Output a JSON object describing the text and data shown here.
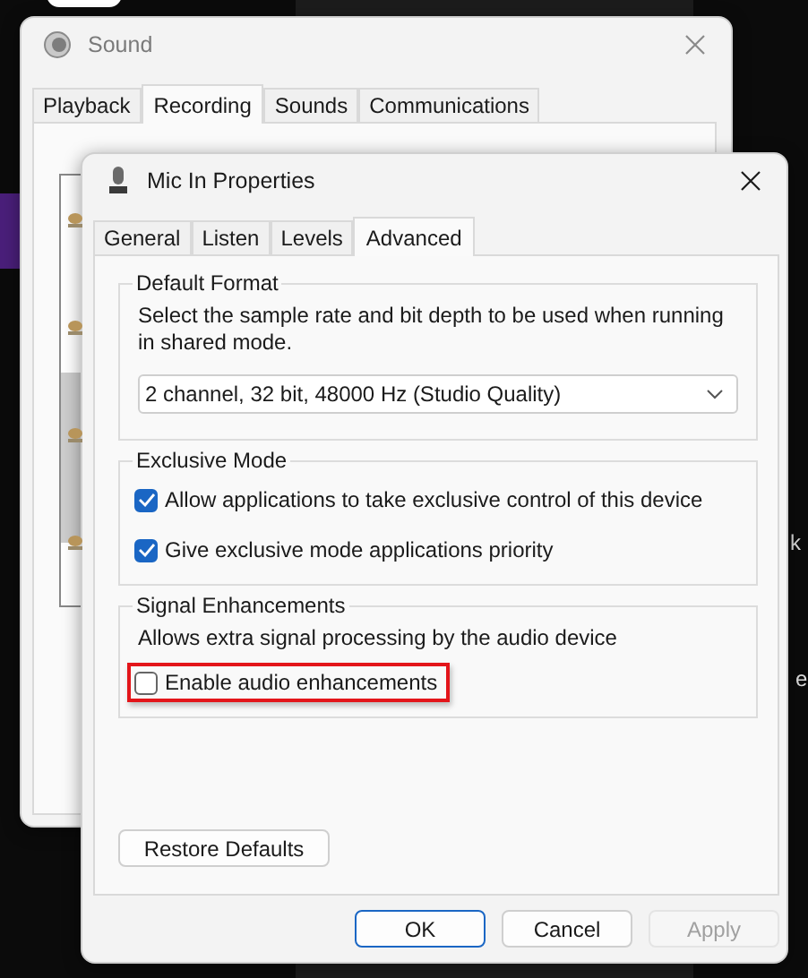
{
  "background": {
    "fragments": [
      "k",
      "e"
    ]
  },
  "sound_window": {
    "title": "Sound",
    "tabs": [
      {
        "label": "Playback",
        "selected": false
      },
      {
        "label": "Recording",
        "selected": true
      },
      {
        "label": "Sounds",
        "selected": false
      },
      {
        "label": "Communications",
        "selected": false
      }
    ]
  },
  "dialog": {
    "title": "Mic In Properties",
    "tabs": [
      {
        "label": "General",
        "selected": false
      },
      {
        "label": "Listen",
        "selected": false
      },
      {
        "label": "Levels",
        "selected": false
      },
      {
        "label": "Advanced",
        "selected": true
      }
    ],
    "groups": [
      {
        "title": "Default Format",
        "description": "Select the sample rate and bit depth to be used when running in shared mode.",
        "dropdown": {
          "value": "2 channel, 32 bit, 48000 Hz (Studio Quality)"
        }
      },
      {
        "title": "Exclusive Mode",
        "options": [
          {
            "label": "Allow applications to take exclusive control of this device",
            "checked": true,
            "highlighted": false
          },
          {
            "label": "Give exclusive mode applications priority",
            "checked": true,
            "highlighted": false
          }
        ]
      },
      {
        "title": "Signal Enhancements",
        "description": "Allows extra signal processing by the audio device",
        "options": [
          {
            "label": "Enable audio enhancements",
            "checked": false,
            "highlighted": true
          }
        ]
      }
    ],
    "restore_button": "Restore Defaults",
    "buttons": [
      {
        "label": "OK",
        "default": true,
        "disabled": false
      },
      {
        "label": "Cancel",
        "default": false,
        "disabled": false
      },
      {
        "label": "Apply",
        "default": false,
        "disabled": true
      }
    ]
  }
}
